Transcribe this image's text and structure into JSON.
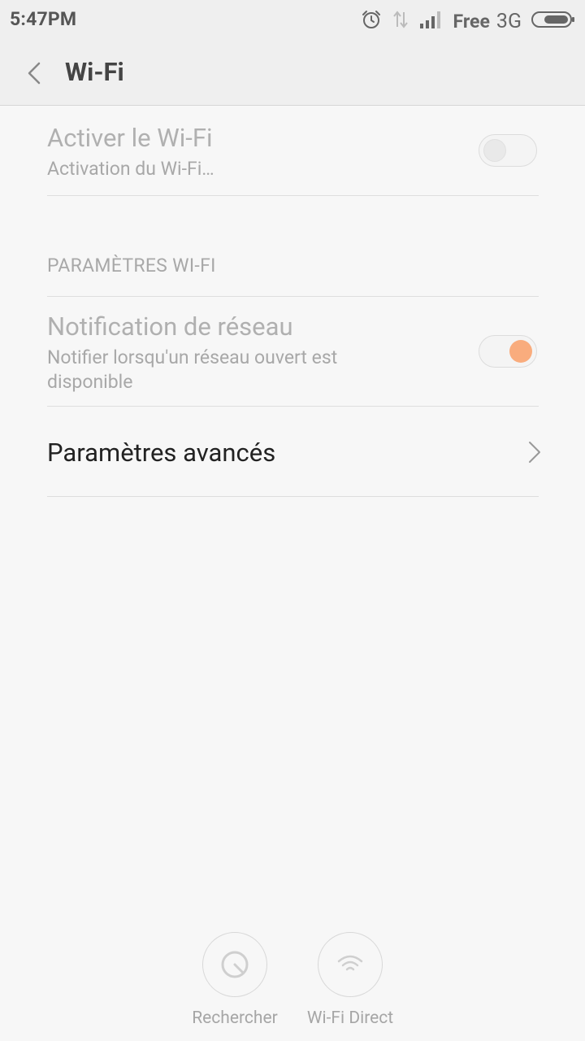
{
  "status_bar": {
    "time": "5:47PM",
    "carrier": "Free",
    "network_type": "3G",
    "icons": [
      "alarm-icon",
      "data-transfer-icon",
      "signal-icon",
      "battery-icon"
    ]
  },
  "header": {
    "title": "Wi-Fi",
    "back_icon": "chevron-left-icon"
  },
  "wifi_toggle": {
    "title": "Activer le Wi-Fi",
    "subtitle": "Activation du Wi-Fi…",
    "state": "off"
  },
  "section": {
    "title": "PARAMÈTRES WI-FI"
  },
  "network_notification": {
    "title": "Notification de réseau",
    "subtitle_line1": "Notifier lorsqu'un réseau ouvert est",
    "subtitle_line2": "disponible",
    "state": "on"
  },
  "advanced": {
    "title": "Paramètres avancés",
    "icon": "chevron-right-icon"
  },
  "bottom_actions": [
    {
      "label": "Rechercher",
      "icon": "search-radar-icon"
    },
    {
      "label": "Wi-Fi Direct",
      "icon": "wifi-icon"
    }
  ],
  "colors": {
    "toggle_on_knob": "#f9ac7d",
    "background": "#f7f7f7",
    "header_background": "#efefef"
  }
}
